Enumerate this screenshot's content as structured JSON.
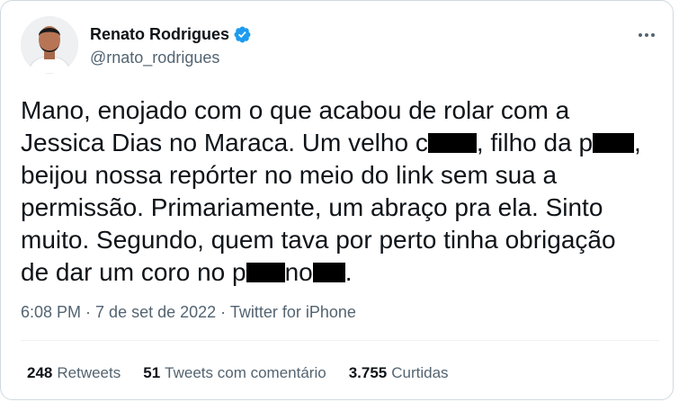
{
  "author": {
    "name": "Renato Rodrigues",
    "handle": "@rnato_rodrigues",
    "verified": true
  },
  "tweet": {
    "text_parts": [
      "Mano, enojado com o que acabou de rolar com a\nJessica Dias no Maraca. Um velho c",
      ", filho da p",
      ",\nbeijou nossa repórter no meio do link sem sua a\npermissão. Primariamente, um abraço pra ela. Sinto\nmuito. Segundo, quem tava por perto tinha obrigação\nde dar um coro no p",
      "no",
      "."
    ]
  },
  "meta": {
    "time": "6:08 PM",
    "separator": " · ",
    "date": "7 de set de 2022",
    "source": "Twitter for iPhone"
  },
  "stats": {
    "retweets_count": "248",
    "retweets_label": "Retweets",
    "quotes_count": "51",
    "quotes_label": "Tweets com comentário",
    "likes_count": "3.755",
    "likes_label": "Curtidas"
  },
  "colors": {
    "verified": "#1d9bf0",
    "text": "#0f1419",
    "secondary": "#536471"
  },
  "icons": [
    "verified-badge-icon",
    "more-options-icon"
  ]
}
